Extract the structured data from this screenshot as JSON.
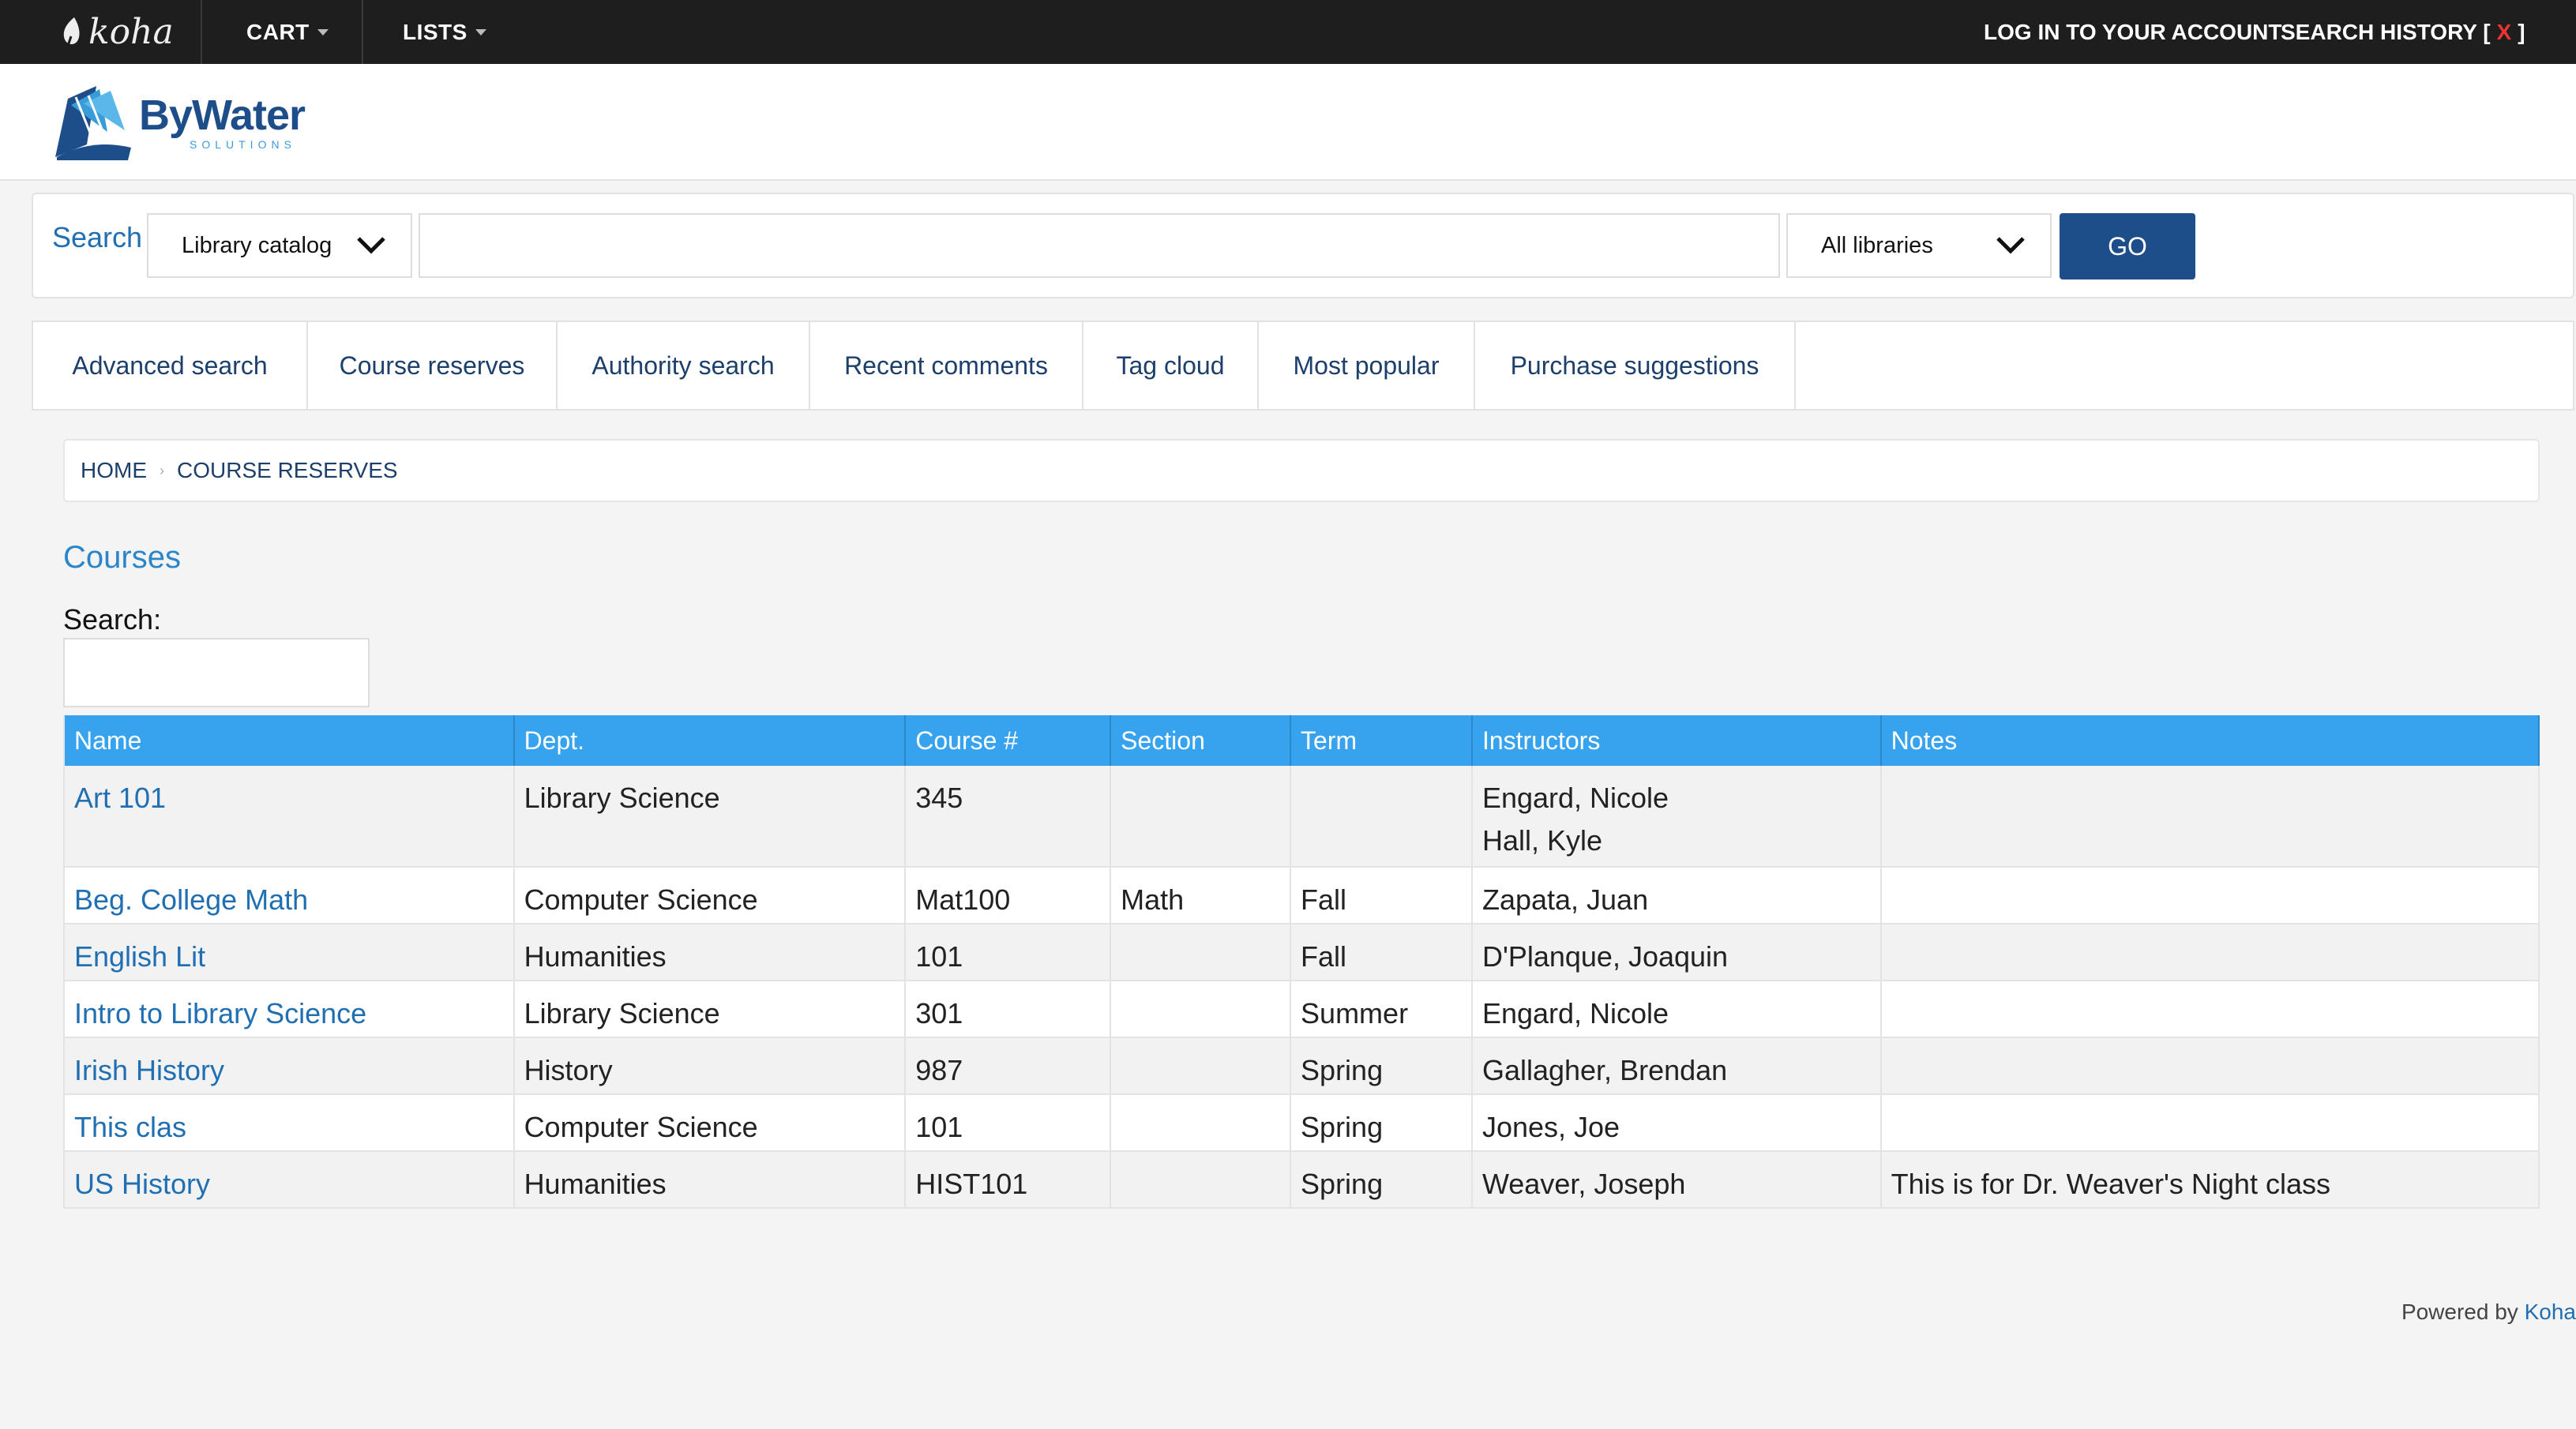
{
  "topbar": {
    "logo_text": "koha",
    "cart_label": "CART",
    "lists_label": "LISTS",
    "login_label": "LOG IN TO YOUR ACCOUNT",
    "search_history_label": "SEARCH HISTORY [",
    "search_history_clear": "X",
    "search_history_close": "]"
  },
  "brand": {
    "name": "ByWater",
    "tagline": "SOLUTIONS"
  },
  "search": {
    "label": "Search",
    "scope_selected": "Library catalog",
    "query_value": "",
    "query_placeholder": "",
    "library_selected": "All libraries",
    "go_label": "GO"
  },
  "menu": [
    "Advanced search",
    "Course reserves",
    "Authority search",
    "Recent comments",
    "Tag cloud",
    "Most popular",
    "Purchase suggestions"
  ],
  "breadcrumb": {
    "home": "HOME",
    "current": "COURSE RESERVES"
  },
  "courses": {
    "title": "Courses",
    "filter_label": "Search:",
    "columns": [
      "Name",
      "Dept.",
      "Course #",
      "Section",
      "Term",
      "Instructors",
      "Notes"
    ],
    "rows": [
      {
        "name": "Art 101",
        "dept": "Library Science",
        "course": "345",
        "section": "",
        "term": "",
        "instructors": [
          "Engard, Nicole",
          "Hall, Kyle"
        ],
        "notes": ""
      },
      {
        "name": "Beg. College Math",
        "dept": "Computer Science",
        "course": "Mat100",
        "section": "Math",
        "term": "Fall",
        "instructors": [
          "Zapata, Juan"
        ],
        "notes": ""
      },
      {
        "name": "English Lit",
        "dept": "Humanities",
        "course": "101",
        "section": "",
        "term": "Fall",
        "instructors": [
          "D'Planque, Joaquin"
        ],
        "notes": ""
      },
      {
        "name": "Intro to Library Science",
        "dept": "Library Science",
        "course": "301",
        "section": "",
        "term": "Summer",
        "instructors": [
          "Engard, Nicole"
        ],
        "notes": ""
      },
      {
        "name": "Irish History",
        "dept": "History",
        "course": "987",
        "section": "",
        "term": "Spring",
        "instructors": [
          "Gallagher, Brendan"
        ],
        "notes": ""
      },
      {
        "name": "This clas",
        "dept": "Computer Science",
        "course": "101",
        "section": "",
        "term": "Spring",
        "instructors": [
          "Jones, Joe"
        ],
        "notes": ""
      },
      {
        "name": "US History",
        "dept": "Humanities",
        "course": "HIST101",
        "section": "",
        "term": "Spring",
        "instructors": [
          "Weaver, Joseph"
        ],
        "notes": "This is for Dr. Weaver's Night class"
      }
    ]
  },
  "footer": {
    "powered_by": "Powered by",
    "koha_link": "Koha"
  }
}
